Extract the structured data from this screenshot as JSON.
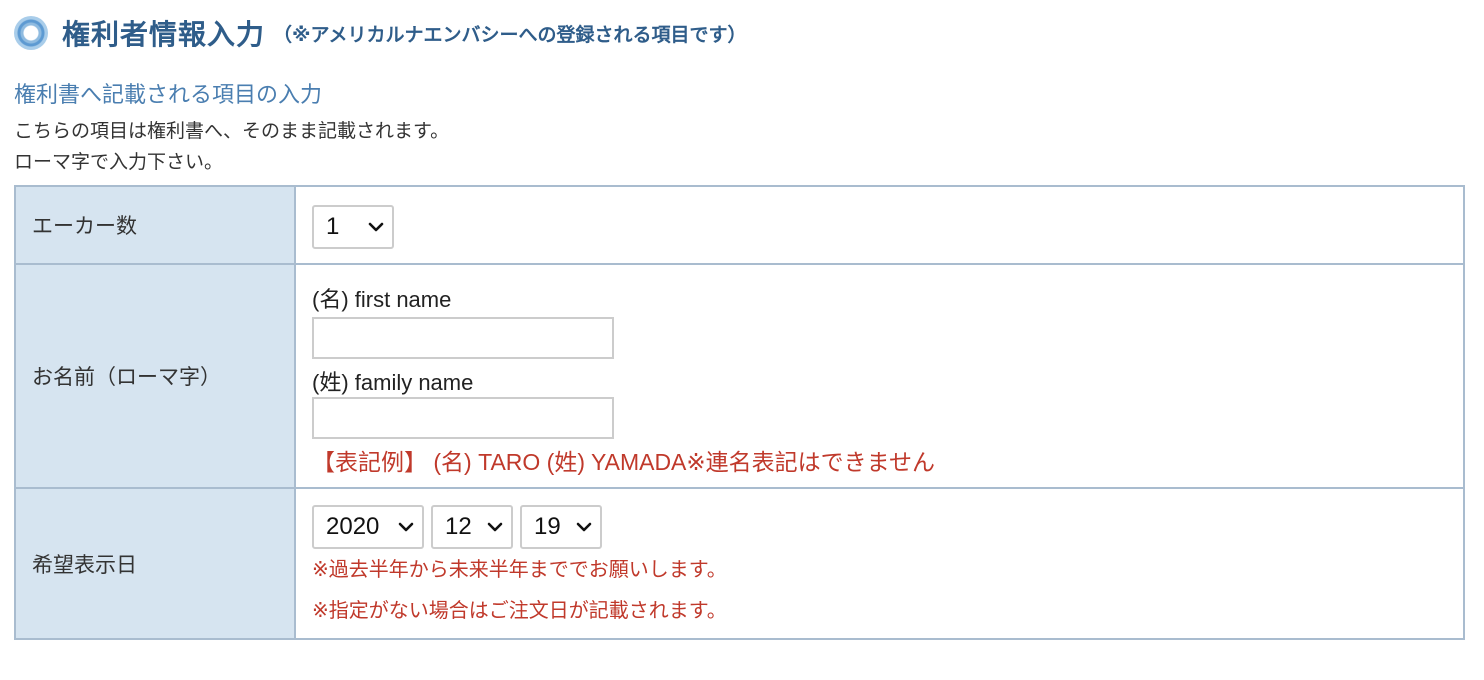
{
  "header": {
    "title": "権利者情報入力",
    "note": "（※アメリカルナエンバシーへの登録される項目です）"
  },
  "section": {
    "subheading": "権利書へ記載される項目の入力",
    "desc_line1": "こちらの項目は権利書へ、そのまま記載されます。",
    "desc_line2": "ローマ字で入力下さい。"
  },
  "form": {
    "acres": {
      "label": "エーカー数",
      "value": "1"
    },
    "name": {
      "label": "お名前（ローマ字）",
      "first_label": "(名) first name",
      "first_value": "",
      "family_label": "(姓) family name",
      "family_value": "",
      "example": "【表記例】 (名) TARO  (姓) YAMADA※連名表記はできません"
    },
    "display_date": {
      "label": "希望表示日",
      "year": "2020",
      "month": "12",
      "day": "19",
      "note1": "※過去半年から未来半年まででお願いします。",
      "note2": "※指定がない場合はご注文日が記載されます。"
    }
  },
  "colors": {
    "title": "#2f5d8a",
    "subheading": "#4a7eb0",
    "label_bg": "#d6e4f0",
    "border": "#a9bccf",
    "warning": "#c0392b"
  },
  "icons": {
    "bullet": "circle-bullet-icon",
    "select_arrow": "chevron-down-icon"
  }
}
